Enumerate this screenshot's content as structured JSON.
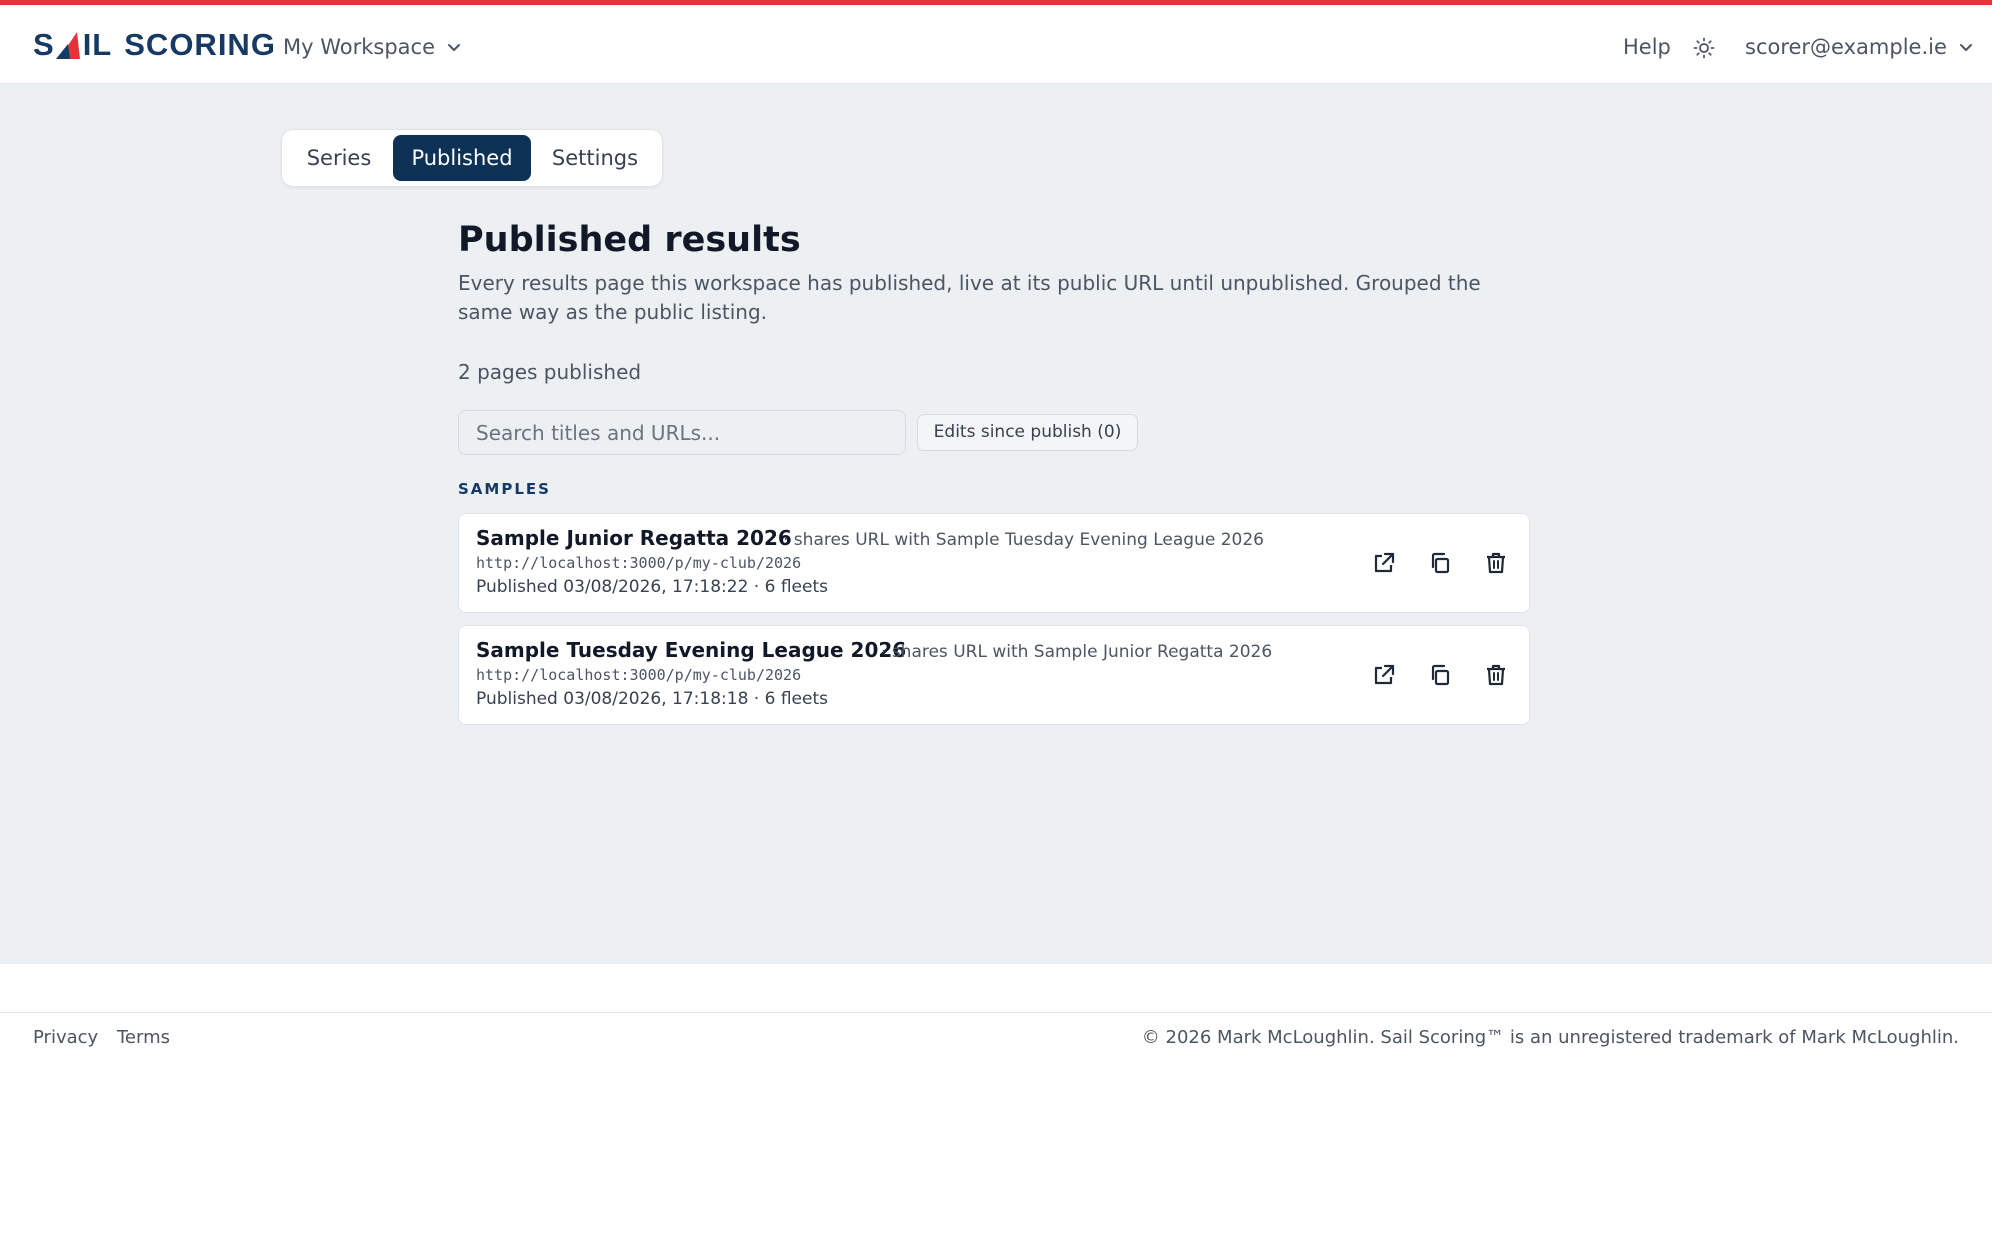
{
  "brand": {
    "accent": "#e5333b",
    "navy": "#0e3256",
    "logo_text": "SAIL SCORING",
    "logo_part1": "S",
    "logo_part2": "IL",
    "logo_part3": "SCORING"
  },
  "header": {
    "workspace": "My Workspace",
    "help": "Help",
    "theme_icon": "sun-icon",
    "user": "scorer@example.ie"
  },
  "tabs": [
    {
      "label": "Series",
      "active": false
    },
    {
      "label": "Published",
      "active": true
    },
    {
      "label": "Settings",
      "active": false
    }
  ],
  "page": {
    "title": "Published results",
    "description": "Every results page this workspace has published, live at its public URL until unpublished. Grouped the same way as the public listing.",
    "count": "2 pages published",
    "search_placeholder": "Search titles and URLs...",
    "edits_button": "Edits since publish (0)"
  },
  "groups": [
    {
      "label": "SAMPLES",
      "items": [
        {
          "title": "Sample Junior Regatta 2026",
          "shares": "· shares URL with Sample Tuesday Evening League 2026",
          "url": "http://localhost:3000/p/my-club/2026",
          "meta": "Published 03/08/2026, 17:18:22 · 6 fleets",
          "actions": [
            "external-link-icon",
            "copy-icon",
            "trash-icon"
          ]
        },
        {
          "title": "Sample Tuesday Evening League 2026",
          "shares": "· shares URL with Sample Junior Regatta 2026",
          "url": "http://localhost:3000/p/my-club/2026",
          "meta": "Published 03/08/2026, 17:18:18 · 6 fleets",
          "actions": [
            "external-link-icon",
            "copy-icon",
            "trash-icon"
          ]
        }
      ]
    }
  ],
  "footer": {
    "privacy": "Privacy",
    "terms": "Terms",
    "copyright": "© 2026 Mark McLoughlin. Sail Scoring™ is an unregistered trademark of Mark McLoughlin."
  }
}
